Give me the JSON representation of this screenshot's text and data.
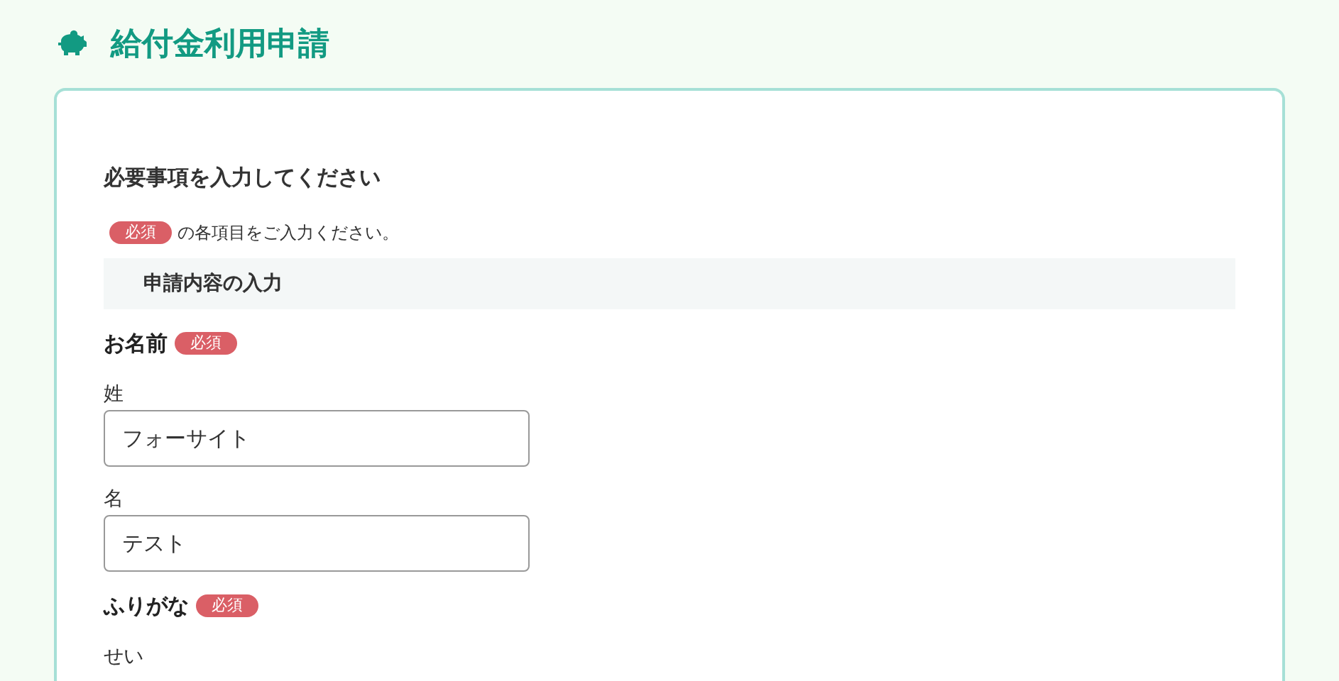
{
  "page": {
    "title": "給付金利用申請"
  },
  "form": {
    "heading": "必要事項を入力してください",
    "notice": {
      "badge": "必須",
      "text": "の各項目をご入力ください。"
    },
    "section": "申請内容の入力",
    "groups": [
      {
        "label": "お名前",
        "badge": "必須",
        "fields": [
          {
            "label": "姓",
            "value": "フォーサイト"
          },
          {
            "label": "名",
            "value": "テスト"
          }
        ]
      },
      {
        "label": "ふりがな",
        "badge": "必須",
        "fields": [
          {
            "label": "せい"
          }
        ]
      }
    ]
  }
}
